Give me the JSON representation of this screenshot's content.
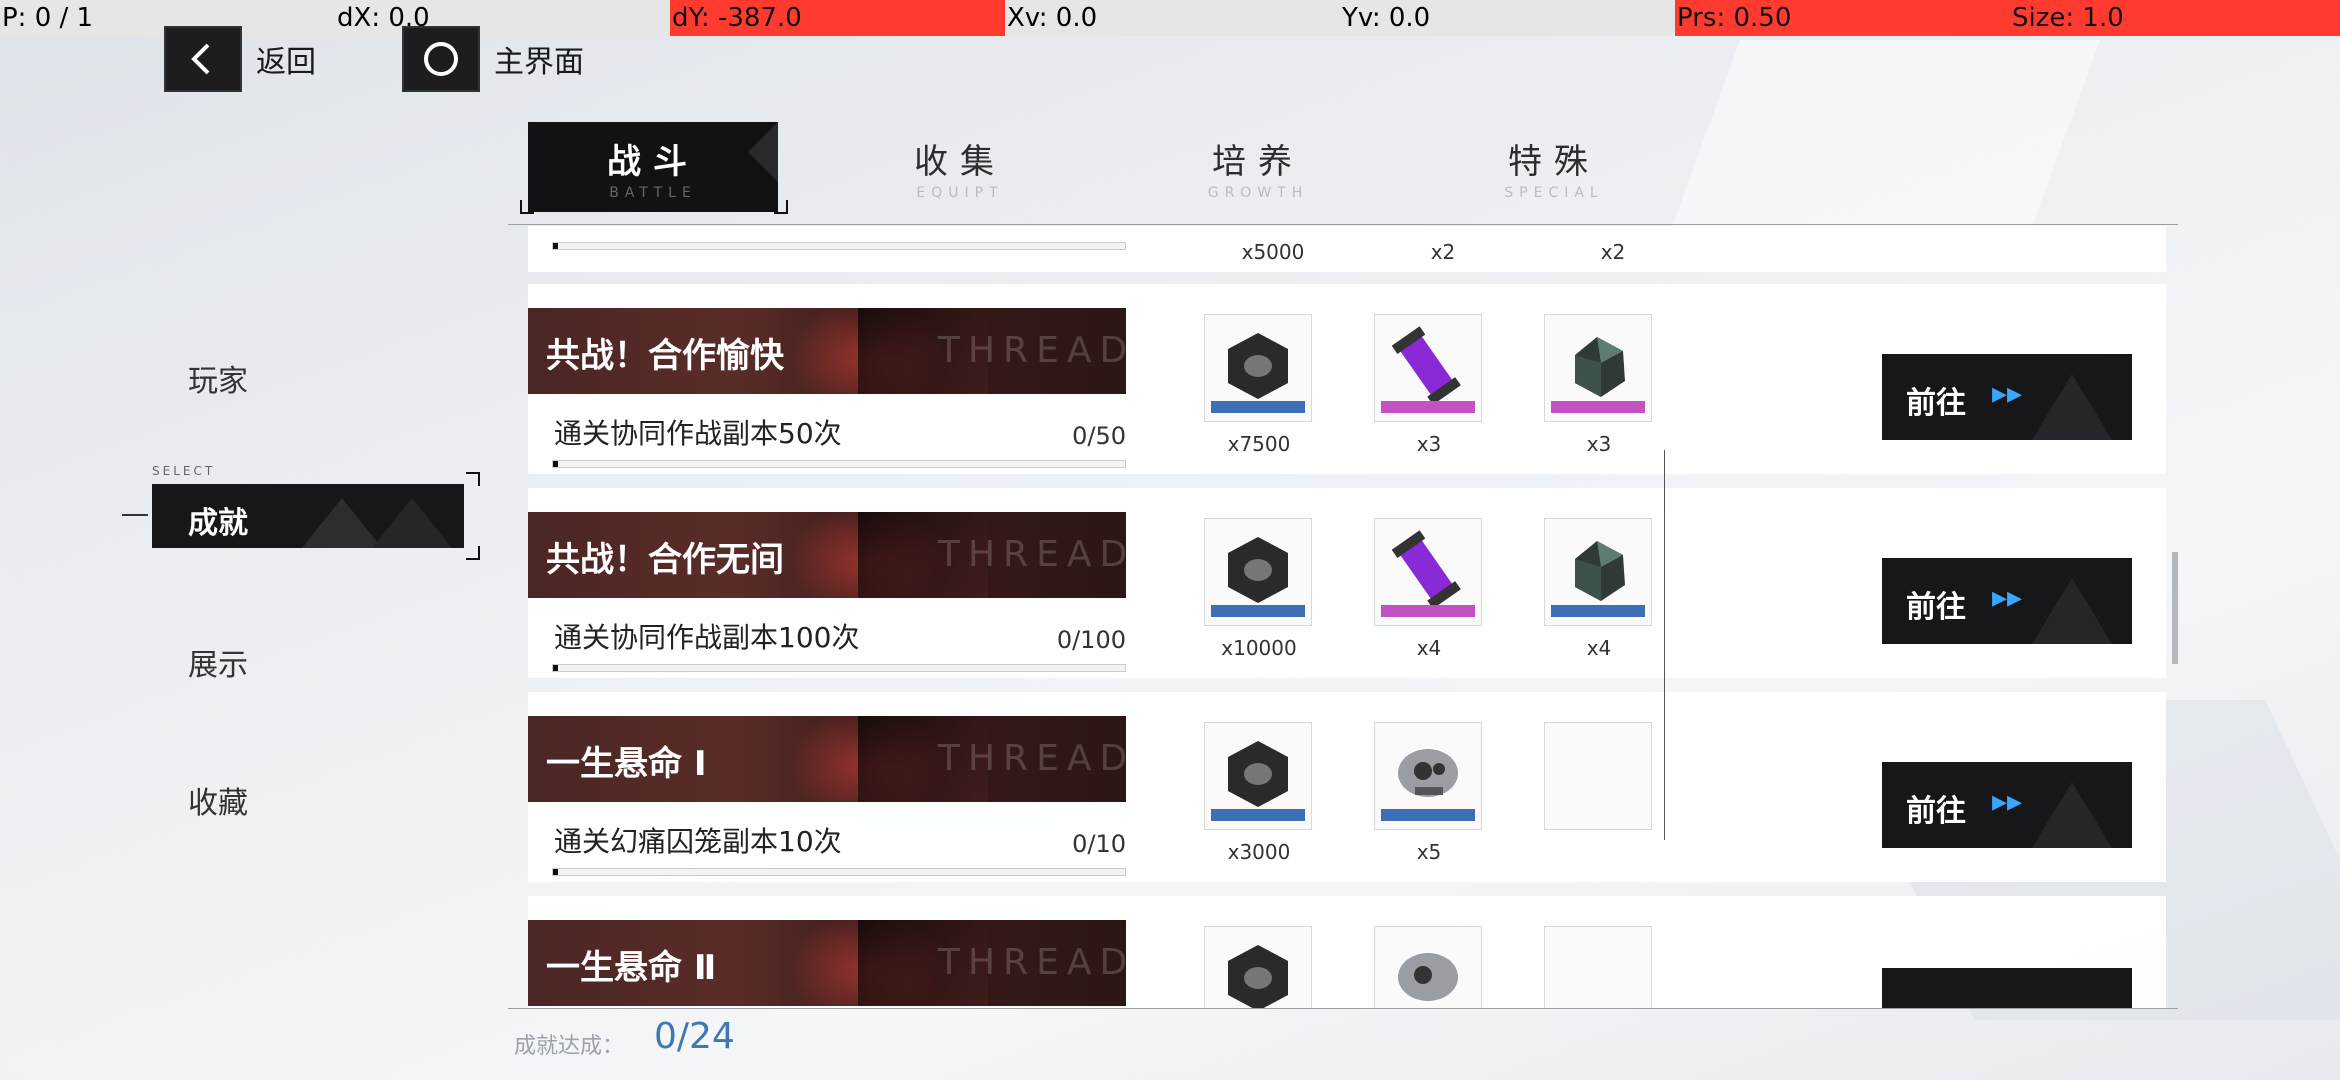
{
  "debug": {
    "p": "P: 0 / 1",
    "dx": "dX: 0.0",
    "dy": "dY: -387.0",
    "xv": "Xv: 0.0",
    "yv": "Yv: 0.0",
    "prs": "Prs: 0.50",
    "size": "Size: 1.0"
  },
  "nav": {
    "back_label": "返回",
    "home_label": "主界面"
  },
  "tabs": [
    {
      "cn": "战斗",
      "en": "BATTLE",
      "active": true
    },
    {
      "cn": "收集",
      "en": "EQUIPT",
      "active": false
    },
    {
      "cn": "培养",
      "en": "GROWTH",
      "active": false
    },
    {
      "cn": "特殊",
      "en": "SPECIAL",
      "active": false
    }
  ],
  "sidebar": {
    "select_hint": "SELECT",
    "items": [
      {
        "label": "玩家",
        "selected": false
      },
      {
        "label": "成就",
        "selected": true
      },
      {
        "label": "展示",
        "selected": false
      },
      {
        "label": "收藏",
        "selected": false
      }
    ]
  },
  "partial_top_row": {
    "qtys": [
      "x5000",
      "x2",
      "x2"
    ]
  },
  "achievements": [
    {
      "title": "共战！合作愉快",
      "watermark": "THREAD",
      "desc": "通关协同作战副本50次",
      "progress": "0/50",
      "progress_fraction": 0,
      "rewards": [
        {
          "icon": "nut-icon",
          "qty": "x7500",
          "color": "#3c6fb5"
        },
        {
          "icon": "purple-vial-icon",
          "qty": "x3",
          "color": "#c252c4"
        },
        {
          "icon": "green-crystal-icon",
          "qty": "x3",
          "color": "#c252c4"
        }
      ],
      "go_label": "前往"
    },
    {
      "title": "共战！合作无间",
      "watermark": "THREAD",
      "desc": "通关协同作战副本100次",
      "progress": "0/100",
      "progress_fraction": 0,
      "rewards": [
        {
          "icon": "nut-icon",
          "qty": "x10000",
          "color": "#3c6fb5"
        },
        {
          "icon": "purple-vial-icon",
          "qty": "x4",
          "color": "#c252c4"
        },
        {
          "icon": "green-crystal-icon",
          "qty": "x4",
          "color": "#3c6fb5"
        }
      ],
      "go_label": "前往"
    },
    {
      "title": "一生悬命 Ⅰ",
      "watermark": "THREAD",
      "desc": "通关幻痛囚笼副本10次",
      "progress": "0/10",
      "progress_fraction": 0,
      "rewards": [
        {
          "icon": "nut-icon",
          "qty": "x3000",
          "color": "#3c6fb5"
        },
        {
          "icon": "engine-icon",
          "qty": "x5",
          "color": "#3c6fb5"
        },
        {
          "icon": "empty-slot",
          "qty": "",
          "color": ""
        }
      ],
      "go_label": "前往"
    },
    {
      "title": "一生悬命 Ⅱ",
      "watermark": "THREAD",
      "desc": "",
      "progress": "",
      "progress_fraction": 0,
      "rewards": [
        {
          "icon": "nut-icon",
          "qty": "",
          "color": "#3c6fb5"
        },
        {
          "icon": "engine-icon",
          "qty": "",
          "color": "#3c6fb5"
        },
        {
          "icon": "empty-slot",
          "qty": "",
          "color": ""
        }
      ],
      "go_label": ""
    }
  ],
  "footer": {
    "label": "成就达成：",
    "value": "0/24"
  }
}
